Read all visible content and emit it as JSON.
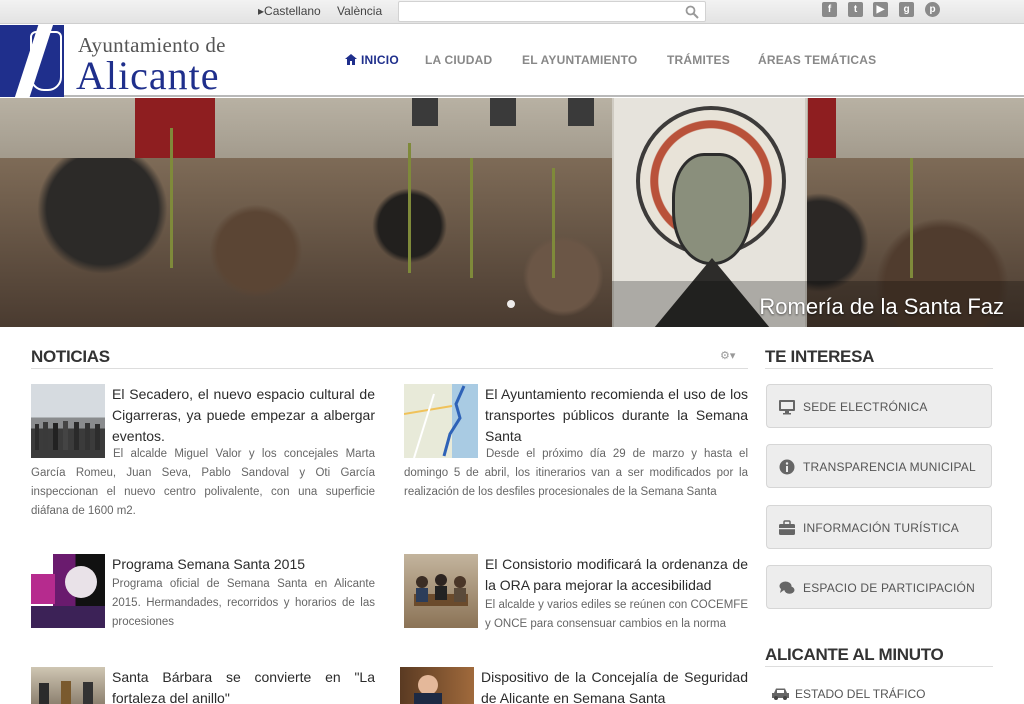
{
  "topbar": {
    "languages": [
      "Castellano",
      "València"
    ],
    "search_placeholder": "",
    "social_icons": [
      "facebook-icon",
      "twitter-icon",
      "youtube-icon",
      "googleplus-icon",
      "pinterest-icon"
    ]
  },
  "header": {
    "logo_top": "Ayuntamiento de",
    "logo_main": "Alicante",
    "nav": [
      "INICIO",
      "LA CIUDAD",
      "EL AYUNTAMIENTO",
      "TRÁMITES",
      "ÁREAS TEMÁTICAS"
    ],
    "active_nav": "INICIO",
    "brand_color": "#1f2f8c"
  },
  "hero": {
    "caption": "Romería de la Santa Faz",
    "slide_count": 1
  },
  "news": {
    "title": "NOTICIAS",
    "items": [
      {
        "title": "El Secadero, el nuevo espacio cultural de Cigarreras, ya puede empezar a albergar eventos.",
        "body": "El alcalde Miguel Valor y los concejales Marta García Romeu, Juan Seva, Pablo Sandoval y Oti García inspeccionan el nuevo centro polivalente, con una superficie diáfana de 1600 m2."
      },
      {
        "title": "El Ayuntamiento recomienda el uso de los transportes públicos durante la Semana Santa",
        "body": "Desde el próximo día 29 de marzo y hasta el domingo 5 de abril, los itinerarios van a ser modificados por la realización de los desfiles procesionales de la Semana Santa"
      },
      {
        "title": "Programa Semana Santa 2015",
        "body": "Programa oficial de Semana Santa en Alicante 2015. Hermandades, recorridos y horarios de las procesiones"
      },
      {
        "title": "El Consistorio modificará la ordenanza de la ORA para mejorar la accesibilidad",
        "body": "El alcalde y varios ediles se reúnen con COCEMFE y ONCE para consensuar cambios en la norma"
      },
      {
        "title": "Santa Bárbara se convierte en \"La fortaleza del anillo\"",
        "body": ""
      },
      {
        "title": "Dispositivo de la Concejalía de Seguridad de Alicante en Semana Santa",
        "body": ""
      }
    ]
  },
  "sidebar": {
    "interest_title": "TE INTERESA",
    "buttons": [
      {
        "label": "SEDE ELECTRÓNICA",
        "icon": "monitor-icon"
      },
      {
        "label": "TRANSPARENCIA MUNICIPAL",
        "icon": "info-icon"
      },
      {
        "label": "INFORMACIÓN TURÍSTICA",
        "icon": "briefcase-icon"
      },
      {
        "label": "ESPACIO DE PARTICIPACIÓN",
        "icon": "chat-icon"
      }
    ],
    "minute_title": "ALICANTE AL MINUTO",
    "traffic_label": "ESTADO DEL TRÁFICO"
  }
}
